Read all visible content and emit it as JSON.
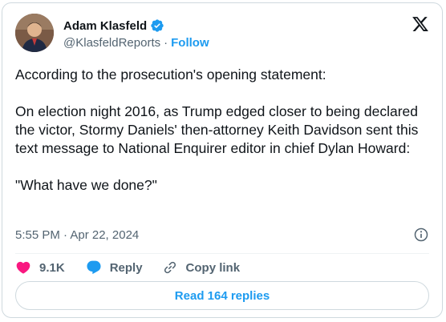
{
  "author": {
    "name": "Adam Klasfeld",
    "handle": "@KlasfeldReports",
    "follow_label": "Follow",
    "separator": "·",
    "avatar": "avatar-photo",
    "verified_icon": "verified-badge-icon"
  },
  "platform_icon": "x-logo-icon",
  "tweet": {
    "paragraphs": [
      "According to the prosecution's opening statement:",
      "On election night 2016, as Trump edged closer to being declared the victor, Stormy Daniels' then-attorney Keith Davidson sent this text message to National Enquirer editor in chief Dylan Howard:",
      "\"What have we done?\""
    ],
    "timestamp": "5:55 PM · Apr 22, 2024"
  },
  "actions": {
    "like_count": "9.1K",
    "reply_label": "Reply",
    "copy_link_label": "Copy link",
    "like_icon": "heart-icon",
    "reply_icon": "reply-bubble-icon",
    "copy_icon": "link-icon",
    "info_icon": "info-icon"
  },
  "footer": {
    "read_replies_label": "Read 164 replies"
  },
  "colors": {
    "accent": "#1d9bf0",
    "like": "#f91880",
    "text": "#0f1419",
    "secondary": "#536471",
    "border": "#cfd9de"
  }
}
